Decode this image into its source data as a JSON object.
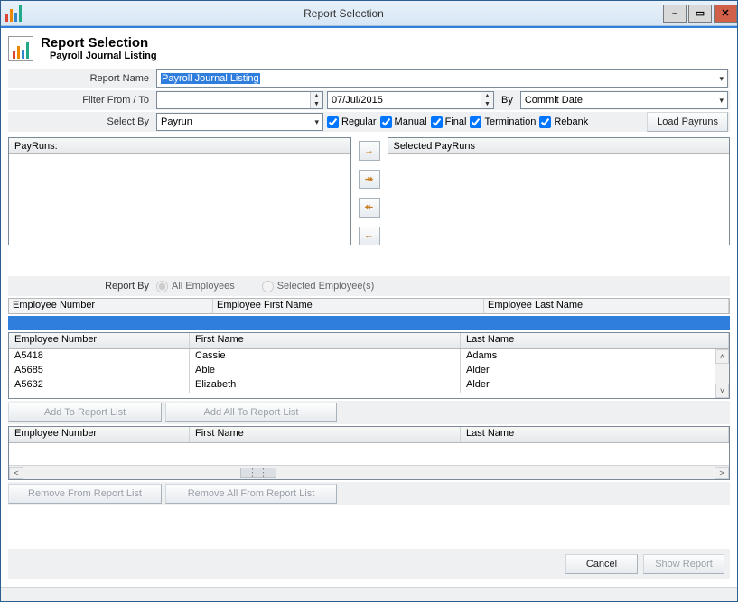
{
  "window": {
    "title": "Report Selection",
    "min": "–",
    "max": "▭",
    "close": "✕"
  },
  "header": {
    "title": "Report Selection",
    "subtitle": "Payroll Journal Listing"
  },
  "labels": {
    "report_name": "Report Name",
    "filter": "Filter From / To",
    "by": "By",
    "select_by": "Select By",
    "report_by": "Report By",
    "payruns": "PayRuns:",
    "selected_payruns": "Selected PayRuns"
  },
  "report_name_value": "Payroll Journal Listing",
  "filter_from": "",
  "filter_to": "07/Jul/2015",
  "by_value": "Commit Date",
  "select_by_value": "Payrun",
  "checks": {
    "regular": "Regular",
    "manual": "Manual",
    "final": "Final",
    "termination": "Termination",
    "rebank": "Rebank"
  },
  "buttons": {
    "load_payruns": "Load Payruns",
    "add": "Add To Report List",
    "add_all": "Add All To Report List",
    "remove": "Remove From Report List",
    "remove_all": "Remove All From Report List",
    "cancel": "Cancel",
    "show": "Show Report"
  },
  "movers": {
    "r": "→",
    "rr": "↠",
    "ll": "↞",
    "l": "←"
  },
  "report_by": {
    "all": "All Employees",
    "selected": "Selected Employee(s)"
  },
  "filter_headers": {
    "en": "Employee Number",
    "fn": "Employee First Name",
    "ln": "Employee Last Name"
  },
  "grid_headers": {
    "en": "Employee Number",
    "fn": "First Name",
    "ln": "Last Name"
  },
  "employees": [
    {
      "num": "A5418",
      "first": "Cassie",
      "last": "Adams"
    },
    {
      "num": "A5685",
      "first": "Able",
      "last": "Alder"
    },
    {
      "num": "A5632",
      "first": "Elizabeth",
      "last": "Alder"
    }
  ]
}
